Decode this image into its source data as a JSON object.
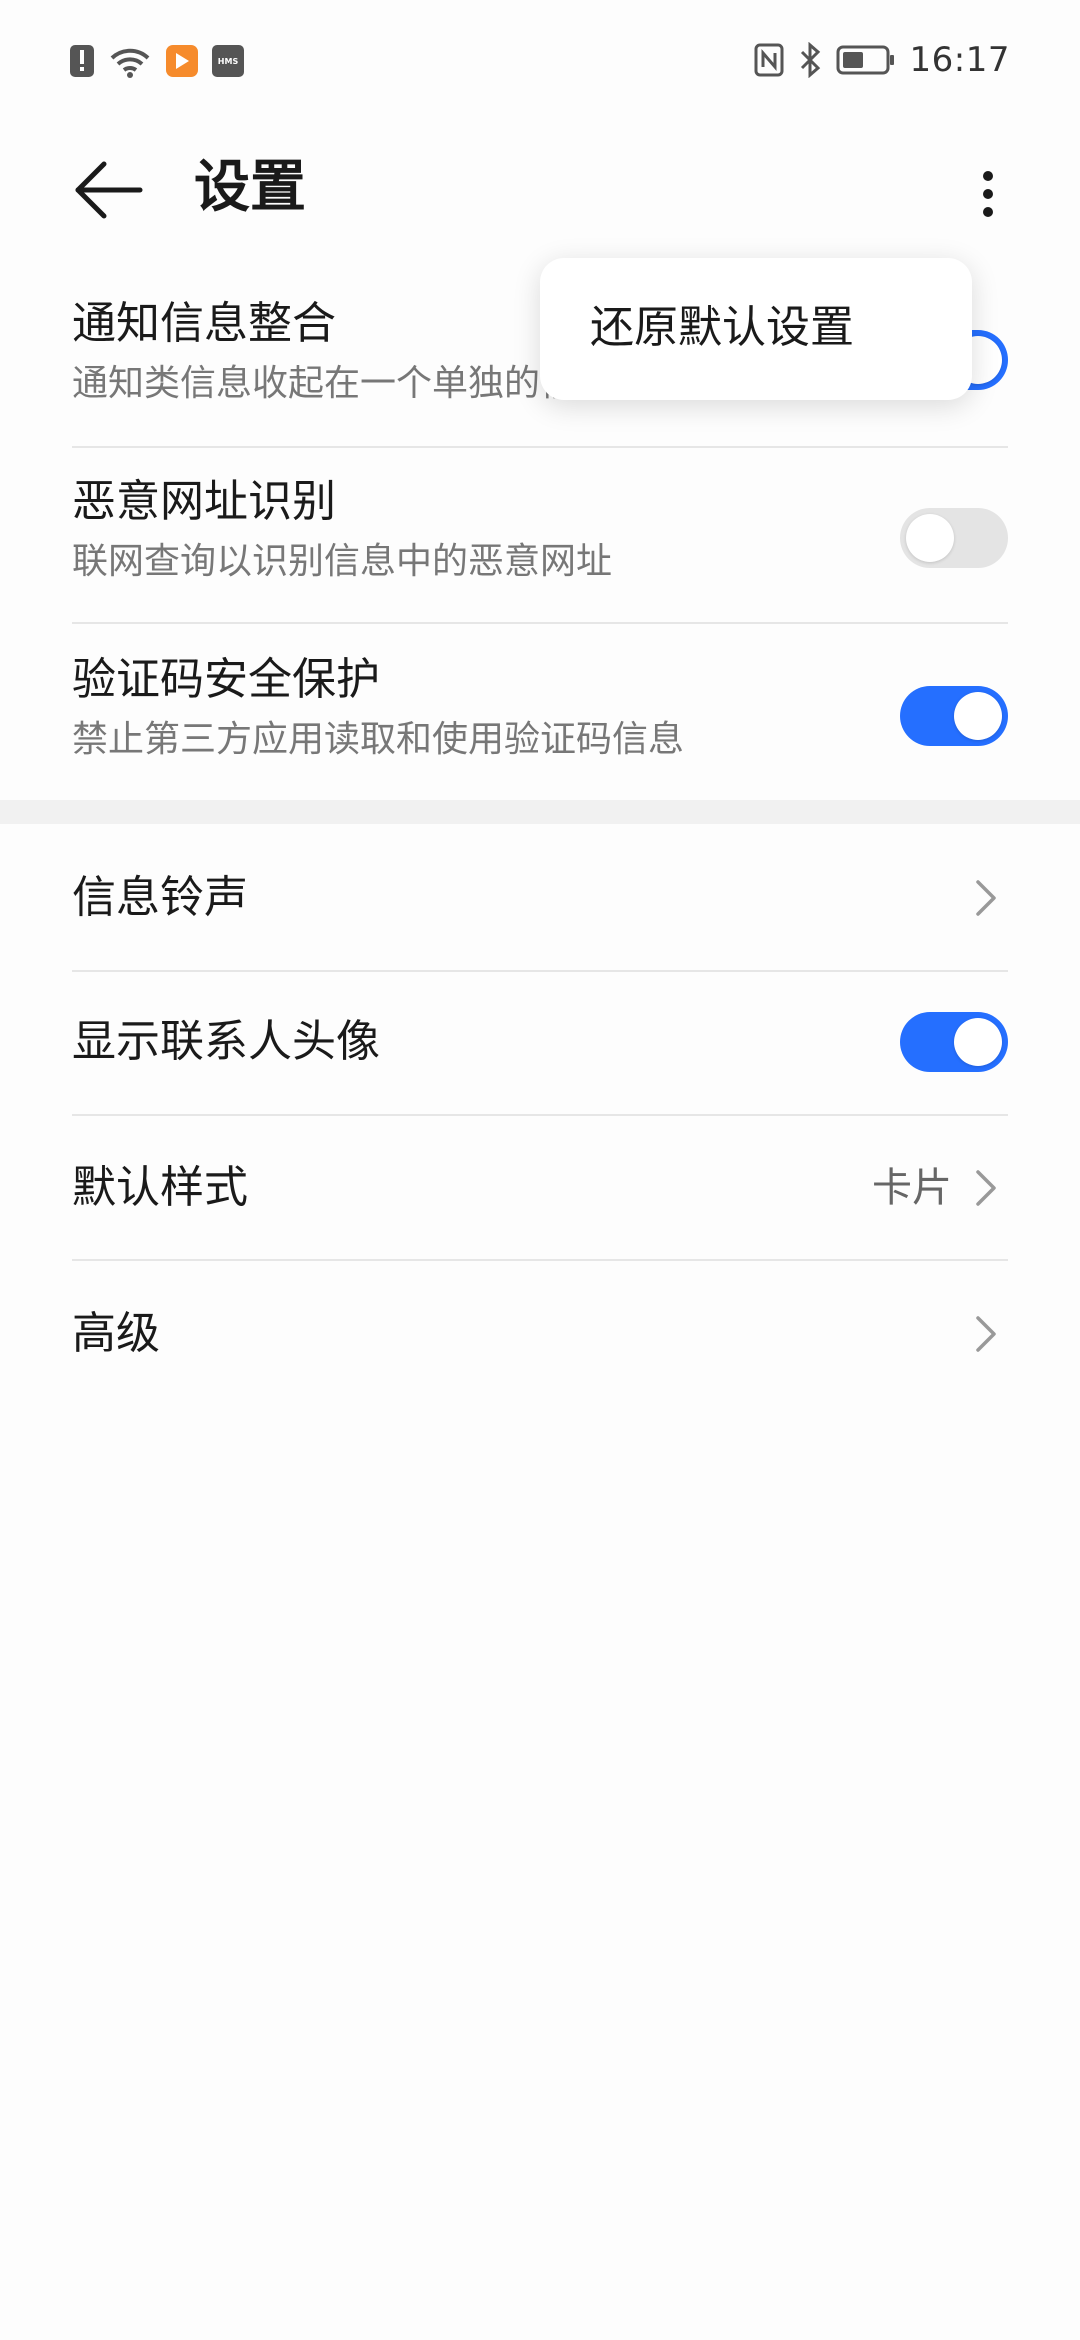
{
  "status_bar": {
    "time": "16:17",
    "hms_label": "HMS",
    "icons": [
      "alert-icon",
      "wifi-icon",
      "video-app-icon",
      "hms-icon",
      "nfc-icon",
      "bluetooth-icon",
      "battery-icon"
    ],
    "battery_level": 0.5
  },
  "app_bar": {
    "title": "设置"
  },
  "settings": {
    "notification_merge": {
      "title": "通知信息整合",
      "subtitle": "通知类信息收起在一个单独的信息列表中",
      "enabled": true
    },
    "malicious_url": {
      "title": "恶意网址识别",
      "subtitle": "联网查询以识别信息中的恶意网址",
      "enabled": false
    },
    "verification_code": {
      "title": "验证码安全保护",
      "subtitle": "禁止第三方应用读取和使用验证码信息",
      "enabled": true
    },
    "ringtone": {
      "title": "信息铃声"
    },
    "show_avatar": {
      "title": "显示联系人头像",
      "enabled": true
    },
    "default_style": {
      "title": "默认样式",
      "value": "卡片"
    },
    "advanced": {
      "title": "高级"
    }
  },
  "popup_menu": {
    "items": [
      {
        "label": "还原默认设置"
      }
    ]
  },
  "colors": {
    "accent": "#256fff",
    "toggle_off": "#e4e4e4",
    "text_primary": "#1a1a1a",
    "text_secondary": "#777777"
  }
}
